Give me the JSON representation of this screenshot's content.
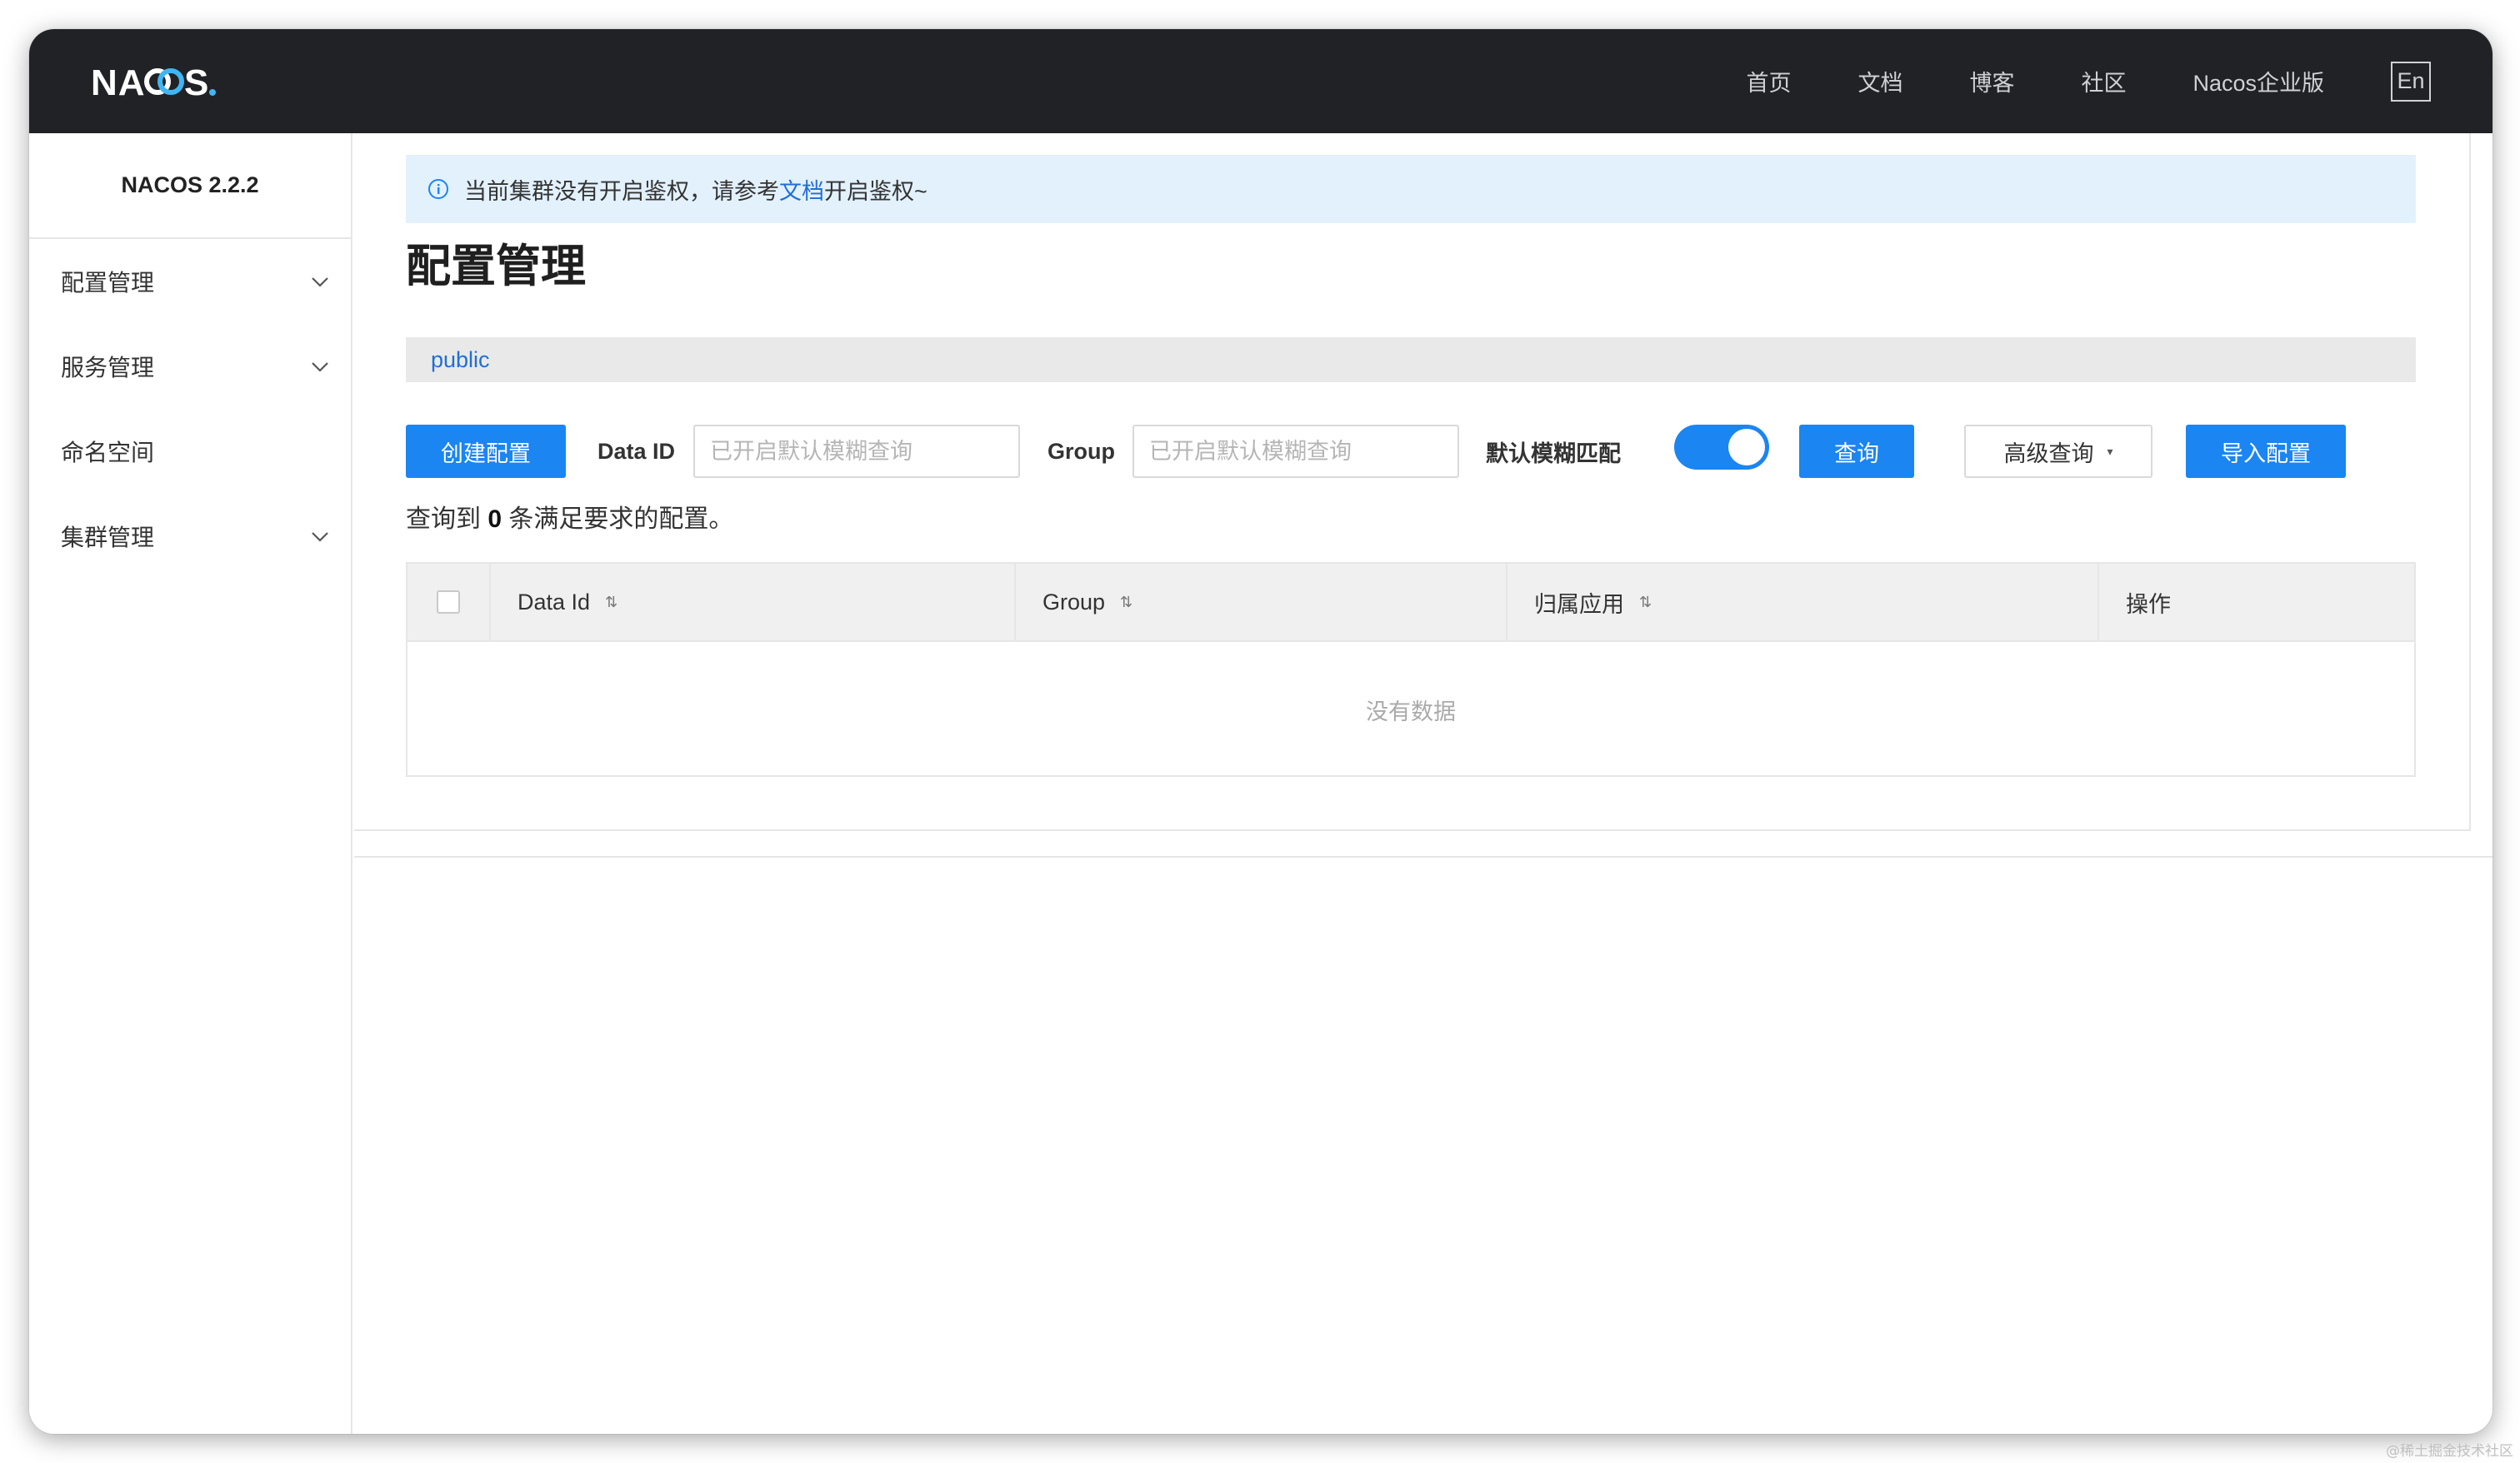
{
  "header": {
    "logo_text": "NACOS.",
    "nav": [
      "首页",
      "文档",
      "博客",
      "社区",
      "Nacos企业版"
    ],
    "lang_button": "En"
  },
  "sidebar": {
    "version": "NACOS 2.2.2",
    "items": [
      {
        "label": "配置管理",
        "expandable": true
      },
      {
        "label": "服务管理",
        "expandable": true
      },
      {
        "label": "命名空间",
        "expandable": false
      },
      {
        "label": "集群管理",
        "expandable": true
      }
    ]
  },
  "alert": {
    "text_before": "当前集群没有开启鉴权，请参考",
    "link_text": "文档",
    "text_after": "开启鉴权~"
  },
  "page_title": "配置管理",
  "namespace": "public",
  "toolbar": {
    "create_button": "创建配置",
    "data_id_label": "Data ID",
    "data_id_placeholder": "已开启默认模糊查询",
    "group_label": "Group",
    "group_placeholder": "已开启默认模糊查询",
    "fuzzy_label": "默认模糊匹配",
    "fuzzy_enabled": true,
    "query_button": "查询",
    "advanced_button": "高级查询",
    "import_button": "导入配置"
  },
  "summary": {
    "prefix": "查询到",
    "count": "0",
    "suffix": "条满足要求的配置。"
  },
  "table": {
    "columns": [
      "Data Id",
      "Group",
      "归属应用",
      "操作"
    ],
    "empty_text": "没有数据"
  },
  "watermark": "@稀土掘金技术社区",
  "colors": {
    "header_bg": "#202225",
    "primary": "#1b85f2",
    "link": "#1f6fd6",
    "alert_bg": "#e3f1fd"
  }
}
